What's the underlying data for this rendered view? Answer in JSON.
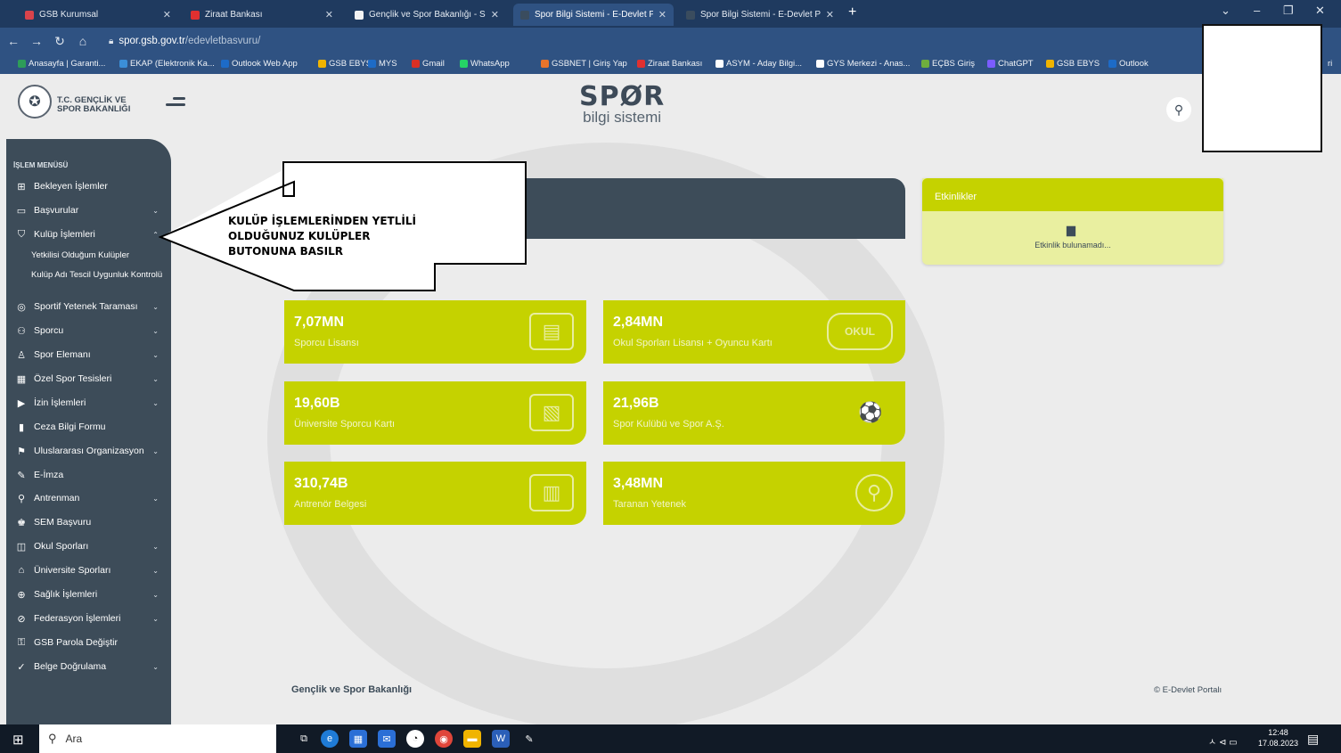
{
  "browser": {
    "tabs": [
      {
        "title": "GSB Kurumsal",
        "fav_color": "#d9434b",
        "active": false
      },
      {
        "title": "Ziraat Bankası",
        "fav_color": "#e03030",
        "active": false
      },
      {
        "title": "Gençlik ve Spor Bakanlığı - Spor",
        "fav_color": "#f3f3f3",
        "active": false
      },
      {
        "title": "Spor Bilgi Sistemi - E-Devlet Port",
        "fav_color": "#3a4c5e",
        "active": true
      },
      {
        "title": "Spor Bilgi Sistemi - E-Devlet Port",
        "fav_color": "#3a4c5e",
        "active": false
      }
    ],
    "new_tab": "+",
    "window_controls": [
      "⌄",
      "–",
      "❐",
      "✕"
    ],
    "url_host": "spor.gsb.gov.tr",
    "url_path": "/edevletbasvuru/",
    "bookmarks": [
      {
        "label": "Anasayfa | Garanti...",
        "color": "#2e9d59"
      },
      {
        "label": "EKAP (Elektronik Ka...",
        "color": "#3b8fd8"
      },
      {
        "label": "Outlook Web App",
        "color": "#1d6bc7"
      },
      {
        "label": "GSB EBYS",
        "color": "#f0b400"
      },
      {
        "label": "MYS",
        "color": "#1d6bc7"
      },
      {
        "label": "Gmail",
        "color": "#d93025"
      },
      {
        "label": "WhatsApp",
        "color": "#25d366"
      },
      {
        "label": "GSBNET | Giriş Yap",
        "color": "#e8742c"
      },
      {
        "label": "Ziraat Bankası",
        "color": "#e03030"
      },
      {
        "label": "ASYM - Aday Bilgi...",
        "color": "#ffffff"
      },
      {
        "label": "GYS Merkezi - Anas...",
        "color": "#ffffff"
      },
      {
        "label": "EÇBS Giriş",
        "color": "#6fae3d"
      },
      {
        "label": "ChatGPT",
        "color": "#7b5cff"
      },
      {
        "label": "GSB EBYS",
        "color": "#f0b400"
      },
      {
        "label": "Outlook",
        "color": "#1d6bc7"
      }
    ],
    "bookmark_overflow": "ri"
  },
  "header": {
    "org_line1": "T.C. GENÇLİK VE",
    "org_line2": "SPOR BAKANLIĞI",
    "brand_main": "SPØR",
    "brand_sub": "bilgi sistemi",
    "search_icon": "search-icon"
  },
  "sidebar": {
    "title": "İŞLEM MENÜSÜ",
    "items": [
      {
        "label": "Bekleyen İşlemler",
        "icon": "⊞",
        "chev": ""
      },
      {
        "label": "Başvurular",
        "icon": "▭",
        "chev": "⌄"
      },
      {
        "label": "Kulüp İşlemleri",
        "icon": "⛉",
        "chev": "⌃"
      },
      {
        "label": "Sportif Yetenek Taraması",
        "icon": "◎",
        "chev": "⌄"
      },
      {
        "label": "Sporcu",
        "icon": "⚇",
        "chev": "⌄"
      },
      {
        "label": "Spor Elemanı",
        "icon": "♙",
        "chev": "⌄"
      },
      {
        "label": "Özel Spor Tesisleri",
        "icon": "▦",
        "chev": "⌄"
      },
      {
        "label": "İzin İşlemleri",
        "icon": "▶",
        "chev": "⌄"
      },
      {
        "label": "Ceza Bilgi Formu",
        "icon": "▮",
        "chev": ""
      },
      {
        "label": "Uluslararası Organizasyon",
        "icon": "⚑",
        "chev": "⌄"
      },
      {
        "label": "E-İmza",
        "icon": "✎",
        "chev": ""
      },
      {
        "label": "Antrenman",
        "icon": "⚲",
        "chev": "⌄"
      },
      {
        "label": "SEM Başvuru",
        "icon": "♚",
        "chev": ""
      },
      {
        "label": "Okul Sporları",
        "icon": "◫",
        "chev": "⌄"
      },
      {
        "label": "Üniversite Sporları",
        "icon": "⌂",
        "chev": "⌄"
      },
      {
        "label": "Sağlık İşlemleri",
        "icon": "⊕",
        "chev": "⌄"
      },
      {
        "label": "Federasyon İşlemleri",
        "icon": "⊘",
        "chev": "⌄"
      },
      {
        "label": "GSB Parola Değiştir",
        "icon": "⚿",
        "chev": ""
      },
      {
        "label": "Belge Doğrulama",
        "icon": "✓",
        "chev": "⌄"
      }
    ],
    "subitems": [
      {
        "label": "Yetkilisi Olduğum Kulüpler"
      },
      {
        "label": "Kulüp Adı Tescil Uygunluk Kontrolü"
      }
    ]
  },
  "stats": [
    {
      "value": "7,07MN",
      "label": "Sporcu Lisansı",
      "icon": "license-card-icon",
      "glyph": "▤"
    },
    {
      "value": "2,84MN",
      "label": "Okul Sporları Lisansı + Oyuncu Kartı",
      "icon": "okul-sporlari-icon",
      "glyph": "OKUL"
    },
    {
      "value": "19,60B",
      "label": "Üniversite Sporcu Kartı",
      "icon": "university-card-icon",
      "glyph": "▧"
    },
    {
      "value": "21,96B",
      "label": "Spor Kulübü ve Spor A.Ş.",
      "icon": "sports-balls-icon",
      "glyph": "⚽"
    },
    {
      "value": "310,74B",
      "label": "Antrenör Belgesi",
      "icon": "certificate-icon",
      "glyph": "▥"
    },
    {
      "value": "3,48MN",
      "label": "Taranan Yetenek",
      "icon": "talent-search-icon",
      "glyph": "⚲"
    }
  ],
  "events": {
    "title": "Etkinlikler",
    "empty_text": "Etkinlik bulunamadı..."
  },
  "annotation": {
    "line1": "KULÜP İŞLEMLERİNDEN YETLİLİ",
    "line2": "OLDUĞUNUZ KULÜPLER",
    "line3": "BUTONUNA BASILR"
  },
  "footer": {
    "left": "Gençlik ve Spor Bakanlığı",
    "right": "© E-Devlet Portalı"
  },
  "taskbar": {
    "search_placeholder": "Ara",
    "tray": "ㅅ ⊲ ▭",
    "time": "12:48",
    "date": "17.08.2023"
  }
}
